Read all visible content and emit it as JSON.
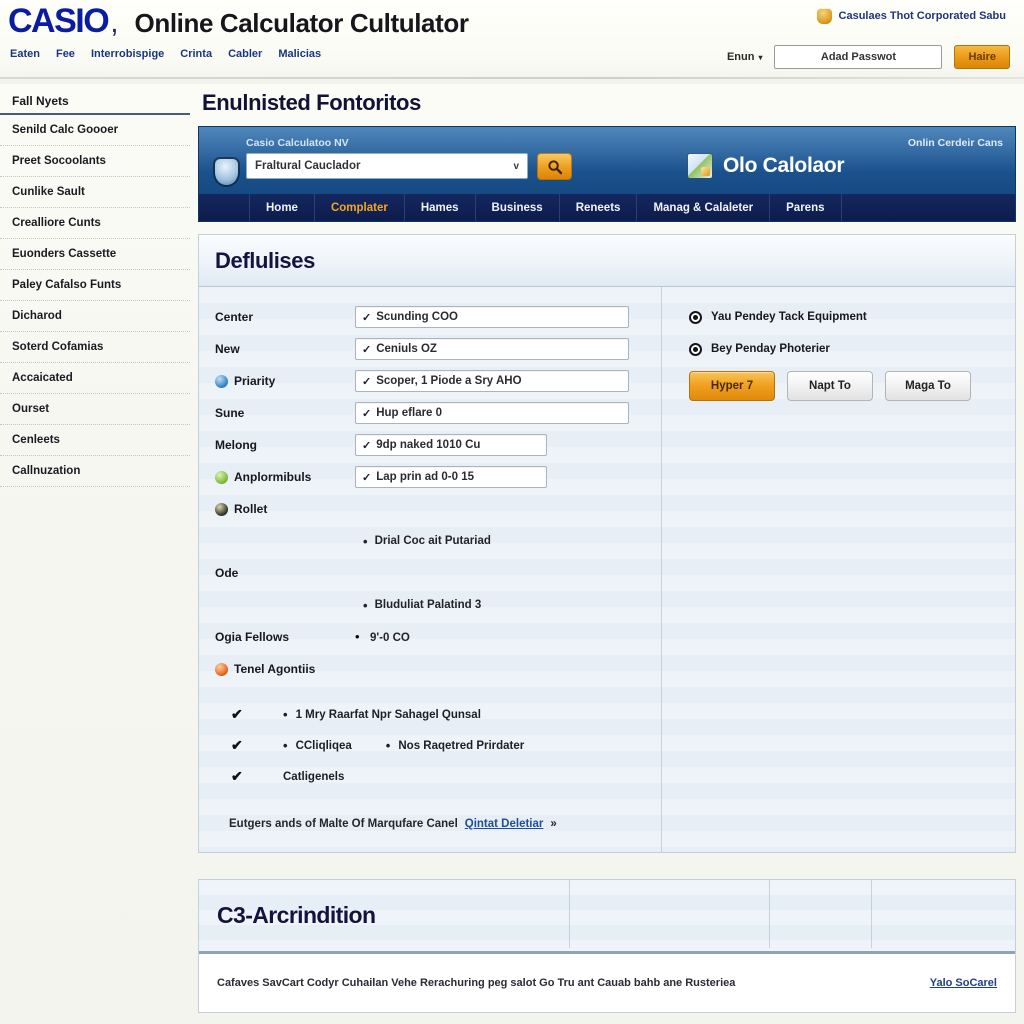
{
  "masthead": {
    "logo": "CASIO",
    "logo_comma": ",",
    "title": "Online Calculator Cultulator",
    "util_links": [
      "Eaten",
      "Fee",
      "Interrobispige",
      "Crinta",
      "Cabler",
      "Malicias"
    ],
    "corp_link": "Casulaes Thot Corporated Sabu",
    "lang_label": "Enun",
    "lang_caret": "▾",
    "login_field_value": "Adad Passwot",
    "login_button": "Haire"
  },
  "sidebar": {
    "heading": "Fall Nyets",
    "items": [
      "Senild Calc Goooer",
      "Preet Socoolants",
      "Cunlike Sault",
      "Crealliore Cunts",
      "Euonders Cassette",
      "Paley Cafalso Funts",
      "Dicharod",
      "Soterd Cofamias",
      "Accaicated",
      "Ourset",
      "Cenleets",
      "Callnuzation"
    ]
  },
  "main": {
    "page_title": "Enulnisted Fontoritos"
  },
  "app_header": {
    "select_label": "Casio Calculatoo NV",
    "select_value": "Fraltural Cauclador",
    "select_caret": "v",
    "search_icon": "search-icon",
    "right_note": "Onlin Cerdeir Cans",
    "product_name": "Olo Calolaor",
    "nav": [
      {
        "label": "Home",
        "active": false
      },
      {
        "label": "Complater",
        "active": true
      },
      {
        "label": "Hames",
        "active": false
      },
      {
        "label": "Business",
        "active": false
      },
      {
        "label": "Reneets",
        "active": false
      },
      {
        "label": "Manag & Calaleter",
        "active": false
      },
      {
        "label": "Parens",
        "active": false
      }
    ]
  },
  "form_panel": {
    "title": "Deflulises",
    "rows": [
      {
        "label": "Center",
        "icon": "none",
        "value": "Scunding COO",
        "width": "w-full"
      },
      {
        "label": "New",
        "icon": "none",
        "value": "Ceniuls OZ",
        "width": "w-full"
      },
      {
        "label": "Priarity",
        "icon": "blue",
        "value": "Scoper, 1 Piode a Sry AHO",
        "width": "w-full"
      },
      {
        "label": "Sune",
        "icon": "none",
        "value": "Hup eflare 0",
        "width": "w-full"
      },
      {
        "label": "Melong",
        "icon": "none",
        "value": "9dp naked 1010 Cu",
        "width": "w-mid"
      },
      {
        "label": "Anplormibuls",
        "icon": "green",
        "value": "Lap prin ad 0-0 15",
        "width": "w-mid"
      }
    ],
    "sub_rows": [
      {
        "label": "Rollet",
        "icon": "dark",
        "bullet": ""
      },
      {
        "label": "",
        "icon": "none",
        "bullet": "Drial Coc ait Putariad"
      },
      {
        "label": "Ode",
        "icon": "none",
        "bullet": ""
      },
      {
        "label": "",
        "icon": "none",
        "bullet": "Bluduliat Palatind 3"
      },
      {
        "label": "Ogia Fellows",
        "icon": "none",
        "bullet": "9'-0 CO"
      },
      {
        "label": "Tenel Agontiis",
        "icon": "red",
        "bullet": ""
      }
    ],
    "radios": [
      {
        "label": "Yau Pendey Tack Equipment",
        "selected": true
      },
      {
        "label": "Bey Penday Photerier",
        "selected": true
      }
    ],
    "buttons": [
      {
        "label": "Hyper 7",
        "style": "primary"
      },
      {
        "label": "Napt To",
        "style": "secondary"
      },
      {
        "label": "Maga To",
        "style": "secondary"
      }
    ],
    "checks": [
      {
        "checked": true,
        "bullet": "•",
        "text": "1 Mry Raarfat Npr Sahagel Qunsal",
        "extra": ""
      },
      {
        "checked": true,
        "bullet": "•",
        "text": "CCliqliqea",
        "extra": "Nos Raqetred Prirdater"
      },
      {
        "checked": true,
        "bullet": "",
        "text": "Catligenels",
        "extra": ""
      }
    ],
    "note_text": "Eutgers ands of Malte Of Marqufare Canel",
    "note_link": "Qintat Deletiar",
    "note_tail": "»"
  },
  "bottom_panel": {
    "title": "C3-Arcrindition",
    "footer_text": "Cafaves SavCart Codyr Cuhailan Vehe Rerachuring peg salot Go Tru ant Cauab bahb ane Rusteriea",
    "footer_link": "Yalo SoCarel"
  },
  "colors": {
    "brand_blue": "#0a1d9e",
    "header_blue": "#1c5490",
    "nav_blue": "#0e1c4c",
    "accent_orange": "#f0a020",
    "link_blue": "#1e4f9c"
  }
}
